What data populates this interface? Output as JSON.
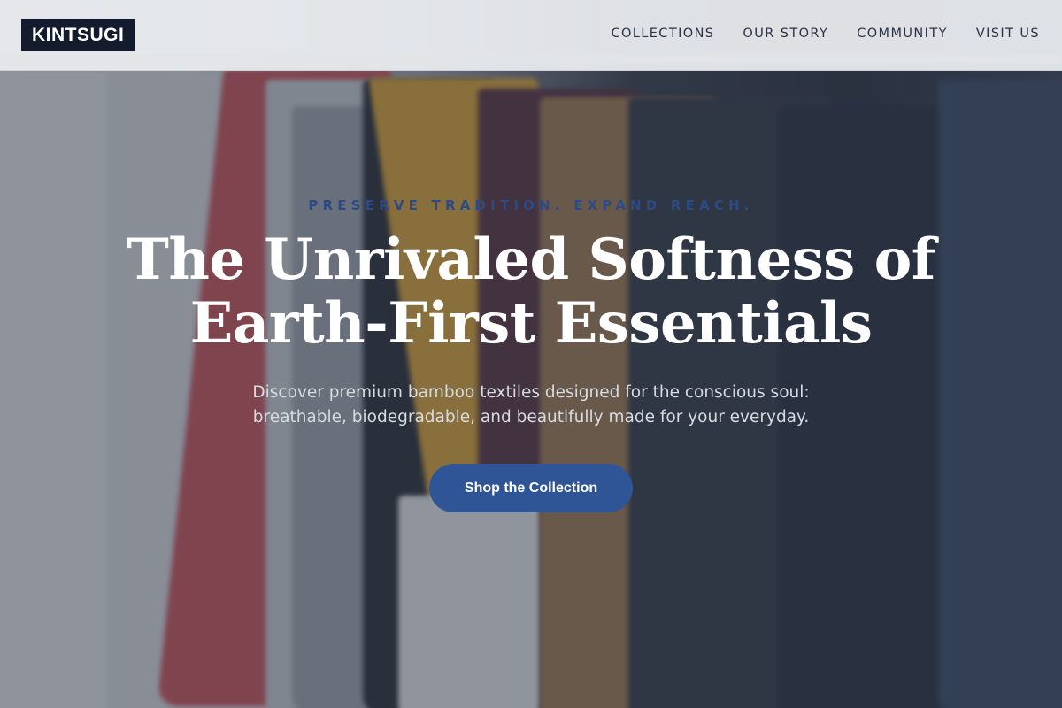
{
  "brand": {
    "logo_text": "KINTSUGI"
  },
  "nav": {
    "items": [
      {
        "label": "COLLECTIONS"
      },
      {
        "label": "OUR STORY"
      },
      {
        "label": "COMMUNITY"
      },
      {
        "label": "VISIT US"
      }
    ]
  },
  "hero": {
    "eyebrow": "PRESERVE TRADITION. EXPAND REACH.",
    "headline_line1": "The Unrivaled Softness of",
    "headline_line2": "Earth-First Essentials",
    "subtitle_line1": "Discover premium bamboo textiles designed for the conscious soul:",
    "subtitle_line2": "breathable, biodegradable, and beautifully made for your everyday.",
    "cta_label": "Shop the Collection",
    "background_image": "blurred clothing rack of t-shirts"
  },
  "colors": {
    "brand_bg": "#141b2d",
    "accent": "#2f5597",
    "eyebrow": "#2c4a86",
    "navbar_bg": "#eceef1"
  }
}
